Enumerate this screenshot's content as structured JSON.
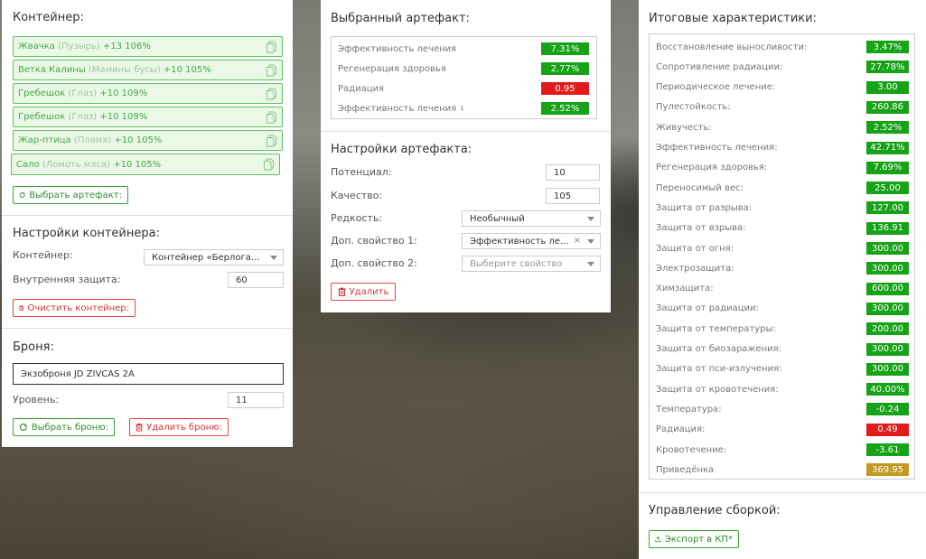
{
  "container": {
    "title": "Контейнер:",
    "slots": [
      {
        "name": "Жвачка",
        "sub": "(Пузырь)",
        "bonus": "+13 106%"
      },
      {
        "name": "Ветка Калины",
        "sub": "(Мамины бусы)",
        "bonus": "+10 105%"
      },
      {
        "name": "Гребешок",
        "sub": "(Глаз)",
        "bonus": "+10 109%"
      },
      {
        "name": "Гребешок",
        "sub": "(Глаз)",
        "bonus": "+10 109%"
      },
      {
        "name": "Жар-птица",
        "sub": "(Пламя)",
        "bonus": "+10 105%"
      },
      {
        "name": "Сало",
        "sub": "(Ломоть мяса)",
        "bonus": "+10 105%"
      }
    ],
    "select_artifact_label": "Выбрать артефакт:"
  },
  "container_settings": {
    "title": "Настройки контейнера:",
    "container_label": "Контейнер:",
    "container_value": "Контейнер «Берлога...",
    "protection_label": "Внутренняя защита:",
    "protection_value": "60",
    "clear_label": "Очистить контейнер:"
  },
  "armor": {
    "title": "Броня:",
    "name_value": "Экзоброня JD ZIVCAS 2A",
    "level_label": "Уровень:",
    "level_value": "11",
    "select_label": "Выбрать броню:",
    "delete_label": "Удалить броню:"
  },
  "selected_artifact": {
    "title": "Выбранный артефакт:",
    "stats": [
      {
        "name": "Эффективность лечения",
        "sup": "",
        "value": "7.31%",
        "color": "green"
      },
      {
        "name": "Регенерация здоровья",
        "sup": "",
        "value": "2.77%",
        "color": "green"
      },
      {
        "name": "Радиация",
        "sup": "",
        "value": "0.95",
        "color": "red"
      },
      {
        "name": "Эффективность лечения",
        "sup": "1",
        "value": "2.52%",
        "color": "green"
      }
    ]
  },
  "artifact_settings": {
    "title": "Настройки артефакта:",
    "potential_label": "Потенциал:",
    "potential_value": "10",
    "quality_label": "Качество:",
    "quality_value": "105",
    "rarity_label": "Редкость:",
    "rarity_value": "Необычный",
    "extra1_label": "Доп. свойство 1:",
    "extra1_value": "Эффективность ле...",
    "extra2_label": "Доп. свойство 2:",
    "extra2_placeholder": "Выберите свойство",
    "delete_label": "Удалить"
  },
  "totals": {
    "title": "Итоговые характеристики:",
    "stats": [
      {
        "name": "Восстановление выносливости:",
        "value": "3.47%",
        "color": "green"
      },
      {
        "name": "Сопротивление радиации:",
        "value": "27.78%",
        "color": "green"
      },
      {
        "name": "Периодическое лечение:",
        "value": "3.00",
        "color": "green"
      },
      {
        "name": "Пулестойкость:",
        "value": "260.86",
        "color": "green"
      },
      {
        "name": "Живучесть:",
        "value": "2.52%",
        "color": "green"
      },
      {
        "name": "Эффективность лечения:",
        "value": "42.71%",
        "color": "green"
      },
      {
        "name": "Регенерация здоровья:",
        "value": "7.69%",
        "color": "green"
      },
      {
        "name": "Переносимый вес:",
        "value": "25.00",
        "color": "green"
      },
      {
        "name": "Защита от разрыва:",
        "value": "127.00",
        "color": "green"
      },
      {
        "name": "Защита от взрыва:",
        "value": "136.91",
        "color": "green"
      },
      {
        "name": "Защита от огня:",
        "value": "300.00",
        "color": "green"
      },
      {
        "name": "Электрозащита:",
        "value": "300.00",
        "color": "green"
      },
      {
        "name": "Химзащита:",
        "value": "600.00",
        "color": "green"
      },
      {
        "name": "Защита от радиации:",
        "value": "300.00",
        "color": "green"
      },
      {
        "name": "Защита от температуры:",
        "value": "200.00",
        "color": "green"
      },
      {
        "name": "Защита от биозаражения:",
        "value": "300.00",
        "color": "green"
      },
      {
        "name": "Защита от пси-излучения:",
        "value": "300.00",
        "color": "green"
      },
      {
        "name": "Защита от кровотечения:",
        "value": "40.00%",
        "color": "green"
      },
      {
        "name": "Температура:",
        "value": "-0.24",
        "color": "green"
      },
      {
        "name": "Радиация:",
        "value": "0.49",
        "color": "red"
      },
      {
        "name": "Кровотечение:",
        "value": "-3.61",
        "color": "green"
      },
      {
        "name": "Приведёнка",
        "value": "369.95",
        "color": "gold"
      }
    ]
  },
  "build": {
    "title": "Управление сборкой:",
    "export_label": "Экспорт в КП*"
  },
  "colors": {
    "green": "#17a317",
    "red": "#e31a1a",
    "gold": "#c29a22",
    "slot_border": "#62c062",
    "slot_bg": "#eaf8e6"
  }
}
